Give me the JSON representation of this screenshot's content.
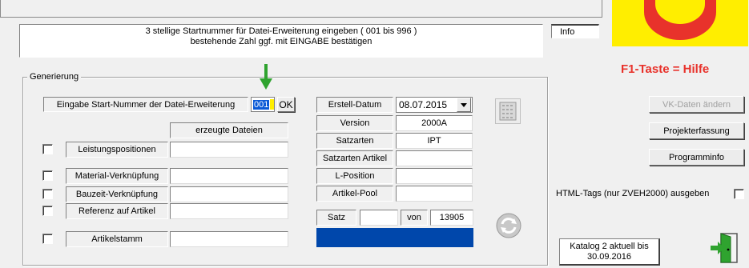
{
  "message": {
    "line1": "3 stellige Startnummer für Datei-Erweiterung eingeben ( 001 bis 996 )",
    "line2": "bestehende Zahl ggf. mit EINGABE bestätigen"
  },
  "info_label": "Info",
  "help_text": "F1-Taste = Hilfe",
  "group": {
    "title": "Generierung",
    "start_label": "Eingabe Start-Nummer der Datei-Erweiterung",
    "start_value": "001",
    "ok_label": "OK",
    "generated_header": "erzeugte Dateien",
    "rows": [
      {
        "label": "Leistungspositionen",
        "value": ""
      },
      {
        "label": "Material-Verknüpfung",
        "value": ""
      },
      {
        "label": "Bauzeit-Verknüpfung",
        "value": ""
      },
      {
        "label": "Referenz auf Artikel",
        "value": ""
      },
      {
        "label": "Artikelstamm",
        "value": ""
      }
    ]
  },
  "details": {
    "erstell_label": "Erstell-Datum",
    "erstell_value": "08.07.2015",
    "version_label": "Version",
    "version_value": "2000A",
    "satzarten_label": "Satzarten",
    "satzarten_value": "IPT",
    "satzarten_artikel_label": "Satzarten Artikel",
    "satzarten_artikel_value": "",
    "lposition_label": "L-Position",
    "lposition_value": "",
    "artikelpool_label": "Artikel-Pool",
    "artikelpool_value": "",
    "satz_label": "Satz",
    "satz_value": "",
    "von_label": "von",
    "von_value": "13905"
  },
  "buttons": {
    "vk_daten": "VK-Daten ändern",
    "projekterfassung": "Projekterfassung",
    "programminfo": "Programminfo"
  },
  "html_tags_label": "HTML-Tags (nur ZVEH2000) ausgeben",
  "katalog": {
    "line1": "Katalog 2 aktuell bis",
    "line2": "30.09.2016"
  },
  "colors": {
    "progress_blue": "#0047ab",
    "help_red": "#e8322b",
    "logo_yellow": "#ffee00",
    "arrow_green": "#2fa32f"
  }
}
